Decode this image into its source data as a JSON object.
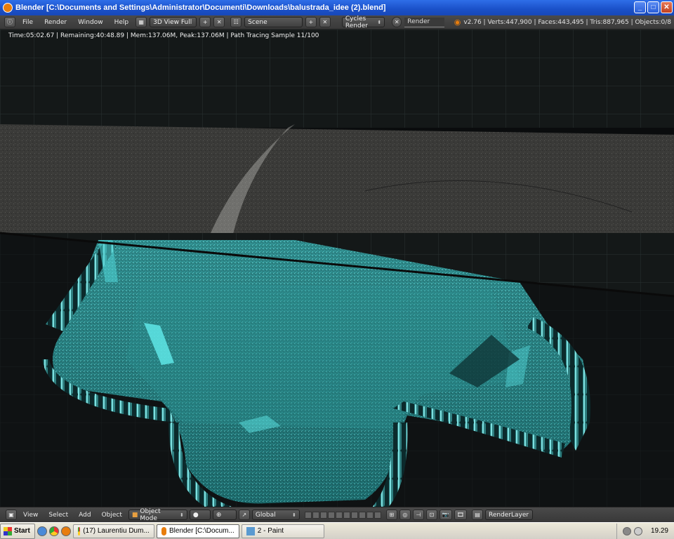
{
  "window": {
    "title": "Blender  [C:\\Documents and Settings\\Administrator\\Documenti\\Downloads\\balustrada_idee (2).blend]",
    "minimize_glyph": "_",
    "maximize_glyph": "□",
    "close_glyph": "✕"
  },
  "header": {
    "menus": [
      "File",
      "Render",
      "Window",
      "Help"
    ],
    "screen_layout": "3D View Full",
    "scene": "Scene",
    "render_engine": "Cycles Render",
    "render_field": "Render",
    "stats": "v2.76 | Verts:447,900 | Faces:443,495 | Tris:887,965 | Objects:0/8"
  },
  "viewport": {
    "render_info": "Time:05:02.67 | Remaining:40:48.89 | Mem:137.06M, Peak:137.06M | Path Tracing Sample 11/100"
  },
  "view_header": {
    "menus": [
      "View",
      "Select",
      "Add",
      "Object"
    ],
    "mode": "Object Mode",
    "orientation": "Global",
    "render_layer": "RenderLayer"
  },
  "taskbar": {
    "start": "Start",
    "tasks": [
      {
        "label": "(17) Laurentiu Dum...",
        "icon_color": "#e87d0d",
        "active": false
      },
      {
        "label": "Blender [C:\\Docum...",
        "icon_color": "#e87d0d",
        "active": true
      },
      {
        "label": "2 - Paint",
        "icon_color": "#5a9ad0",
        "active": false
      }
    ],
    "clock": "19.29"
  },
  "colors": {
    "accent_cyan": "#3fd3d6",
    "blender_orange": "#e87d0d",
    "xp_blue": "#2458d8"
  }
}
